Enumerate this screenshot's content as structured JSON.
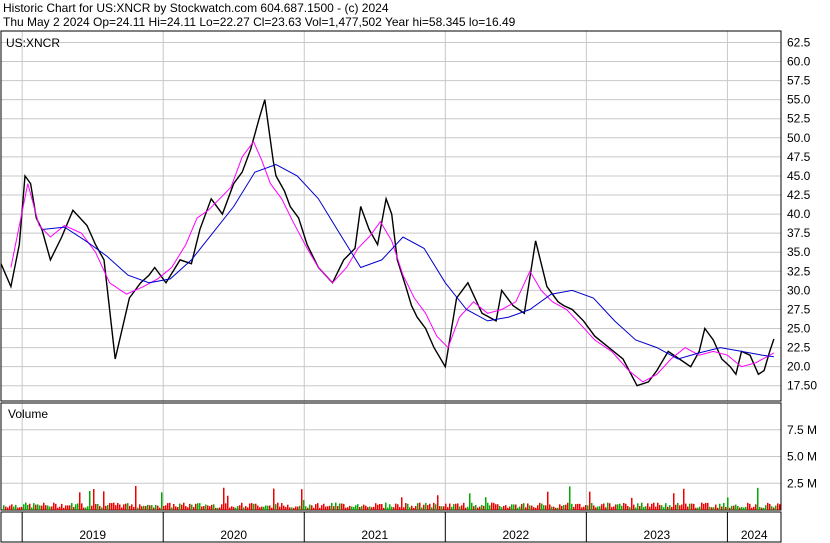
{
  "header": {
    "title_line": "Historic Chart for US:XNCR by Stockwatch.com 604.687.1500 - (c) 2024",
    "stats_line": "Thu May  2 2024   Op=24.11   Hi=24.11   Lo=22.27   Cl=23.63   Vol=1,477,502   Year hi=58.345   lo=16.49"
  },
  "colors": {
    "price": "#000000",
    "ma_short": "#ff00ff",
    "ma_long": "#0000cc",
    "vol_up": "#00aa00",
    "vol_down": "#ee0000",
    "grid": "#c8c8c8"
  },
  "chart_data": [
    {
      "type": "line",
      "title": "US:XNCR",
      "y_ticks": [
        "62.5",
        "60.0",
        "57.5",
        "55.0",
        "52.5",
        "50.0",
        "47.5",
        "45.0",
        "42.5",
        "40.0",
        "37.5",
        "35.0",
        "32.5",
        "30.0",
        "27.5",
        "25.0",
        "22.5",
        "20.0",
        "17.50"
      ],
      "ylim": [
        15.5,
        64
      ],
      "x_ticks": [
        "2019",
        "2020",
        "2021",
        "2022",
        "2023",
        "2024"
      ],
      "x_ticks_t": [
        2019.0,
        2020.0,
        2021.0,
        2022.0,
        2023.0,
        2024.0
      ],
      "xlim": [
        2018.85,
        2024.38
      ],
      "grid": true,
      "series": [
        {
          "t": [
            2018.85,
            2018.92,
            2018.98,
            2019.02,
            2019.06,
            2019.1,
            2019.14,
            2019.2,
            2019.28,
            2019.36,
            2019.46,
            2019.52,
            2019.58,
            2019.66,
            2019.76,
            2019.84,
            2019.9,
            2019.94,
            2020.02,
            2020.12,
            2020.2,
            2020.26,
            2020.34,
            2020.42,
            2020.5,
            2020.56,
            2020.62,
            2020.68,
            2020.72,
            2020.78,
            2020.8,
            2020.86,
            2020.9,
            2020.96,
            2021.02,
            2021.1,
            2021.2,
            2021.28,
            2021.36,
            2021.4,
            2021.46,
            2021.52,
            2021.58,
            2021.62,
            2021.66,
            2021.72,
            2021.76,
            2021.8,
            2021.86,
            2021.92,
            2022.0,
            2022.08,
            2022.16,
            2022.26,
            2022.36,
            2022.4,
            2022.48,
            2022.56,
            2022.64,
            2022.72,
            2022.8,
            2022.84,
            2022.9,
            2022.98,
            2023.06,
            2023.16,
            2023.26,
            2023.36,
            2023.44,
            2023.5,
            2023.58,
            2023.66,
            2023.74,
            2023.8,
            2023.84,
            2023.9,
            2023.96,
            2024.02,
            2024.06,
            2024.1,
            2024.16,
            2024.22,
            2024.26,
            2024.3,
            2024.33
          ],
          "values": [
            33.5,
            30.5,
            36.0,
            45.0,
            44.0,
            39.5,
            38.0,
            34.0,
            37.0,
            40.5,
            38.5,
            36.0,
            34.0,
            21.0,
            29.0,
            31.0,
            32.0,
            33.0,
            31.0,
            34.0,
            33.5,
            38.0,
            42.0,
            40.0,
            44.0,
            45.5,
            48.5,
            52.5,
            55.0,
            47.0,
            45.0,
            43.0,
            41.0,
            39.5,
            36.0,
            33.0,
            31.0,
            34.0,
            35.5,
            41.0,
            38.0,
            36.0,
            42.0,
            40.0,
            34.0,
            30.5,
            28.0,
            26.5,
            25.0,
            22.5,
            20.0,
            29.0,
            31.0,
            27.0,
            26.0,
            30.0,
            28.0,
            27.0,
            36.5,
            30.5,
            28.5,
            28.0,
            27.5,
            26.0,
            24.0,
            22.5,
            21.0,
            17.5,
            18.0,
            19.5,
            22.0,
            21.0,
            20.0,
            22.0,
            25.0,
            23.5,
            21.0,
            20.0,
            19.0,
            22.0,
            21.5,
            19.0,
            19.5,
            22.0,
            23.63
          ]
        },
        {
          "t": [
            2018.92,
            2019.04,
            2019.12,
            2019.2,
            2019.3,
            2019.42,
            2019.52,
            2019.62,
            2019.74,
            2019.86,
            2019.96,
            2020.06,
            2020.16,
            2020.24,
            2020.32,
            2020.4,
            2020.48,
            2020.56,
            2020.64,
            2020.7,
            2020.76,
            2020.84,
            2020.92,
            2021.02,
            2021.1,
            2021.2,
            2021.3,
            2021.38,
            2021.46,
            2021.54,
            2021.62,
            2021.7,
            2021.78,
            2021.86,
            2021.94,
            2022.02,
            2022.1,
            2022.2,
            2022.3,
            2022.4,
            2022.5,
            2022.6,
            2022.68,
            2022.76,
            2022.86,
            2022.96,
            2023.06,
            2023.18,
            2023.3,
            2023.4,
            2023.5,
            2023.6,
            2023.7,
            2023.8,
            2023.9,
            2024.0,
            2024.1,
            2024.2,
            2024.3,
            2024.33
          ],
          "values": [
            33.0,
            44.0,
            38.5,
            37.0,
            38.5,
            37.5,
            35.0,
            31.0,
            29.5,
            30.5,
            31.5,
            33.0,
            36.0,
            39.5,
            40.5,
            42.0,
            43.5,
            47.5,
            49.5,
            47.0,
            44.0,
            42.0,
            39.0,
            35.5,
            33.0,
            31.0,
            33.0,
            35.5,
            37.0,
            39.0,
            36.5,
            32.0,
            29.0,
            27.0,
            24.0,
            22.5,
            26.5,
            28.5,
            27.0,
            27.5,
            28.5,
            32.5,
            30.0,
            28.5,
            27.5,
            25.5,
            23.5,
            22.0,
            19.5,
            18.0,
            19.0,
            21.0,
            22.5,
            21.5,
            22.0,
            21.5,
            20.0,
            20.5,
            21.5,
            21.8
          ]
        },
        {
          "t": [
            2019.15,
            2019.3,
            2019.45,
            2019.6,
            2019.75,
            2019.9,
            2020.05,
            2020.2,
            2020.35,
            2020.5,
            2020.65,
            2020.8,
            2020.95,
            2021.1,
            2021.25,
            2021.4,
            2021.55,
            2021.7,
            2021.85,
            2022.0,
            2022.15,
            2022.3,
            2022.45,
            2022.6,
            2022.75,
            2022.9,
            2023.05,
            2023.2,
            2023.35,
            2023.5,
            2023.65,
            2023.8,
            2023.95,
            2024.1,
            2024.25,
            2024.33
          ],
          "values": [
            38.0,
            38.3,
            36.5,
            34.5,
            32.0,
            31.0,
            31.5,
            34.0,
            37.5,
            41.0,
            45.5,
            46.5,
            45.0,
            42.0,
            37.5,
            33.0,
            34.0,
            37.0,
            35.5,
            31.0,
            27.5,
            26.0,
            26.5,
            27.5,
            29.5,
            30.0,
            29.0,
            26.0,
            23.5,
            22.5,
            21.0,
            21.8,
            22.5,
            22.0,
            21.5,
            21.3
          ]
        }
      ]
    },
    {
      "type": "bar",
      "title": "Volume",
      "y_ticks": [
        "7.5 M",
        "5.0 M",
        "2.5 M"
      ],
      "ylim": [
        0,
        10
      ]
    }
  ]
}
